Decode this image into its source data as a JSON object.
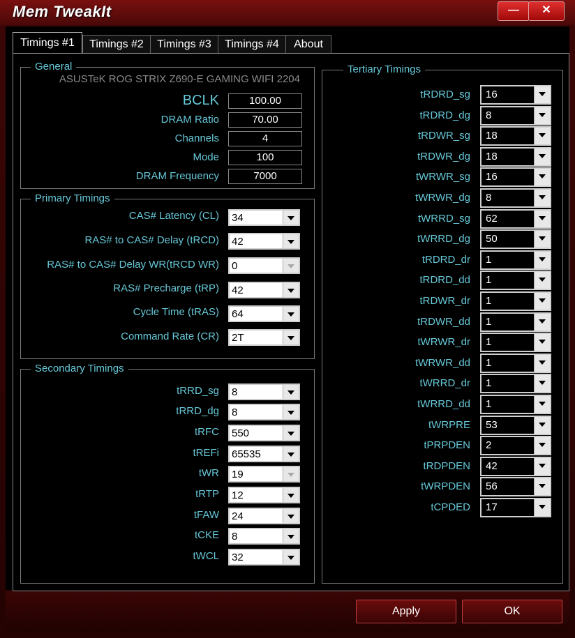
{
  "window": {
    "title": "Mem TweakIt",
    "minimize": "—",
    "close": "✕"
  },
  "tabs": [
    "Timings #1",
    "Timings #2",
    "Timings #3",
    "Timings #4",
    "About"
  ],
  "general": {
    "title": "General",
    "board": "ASUSTeK ROG STRIX Z690-E GAMING WIFI 2204",
    "fields": [
      {
        "label": "BCLK",
        "value": "100.00"
      },
      {
        "label": "DRAM Ratio",
        "value": "70.00"
      },
      {
        "label": "Channels",
        "value": "4"
      },
      {
        "label": "Mode",
        "value": "100"
      },
      {
        "label": "DRAM Frequency",
        "value": "7000"
      }
    ]
  },
  "primary": {
    "title": "Primary Timings",
    "rows": [
      {
        "label": "CAS# Latency (CL)",
        "value": "34"
      },
      {
        "label": "RAS# to CAS# Delay (tRCD)",
        "value": "42"
      },
      {
        "label": "RAS# to CAS# Delay WR(tRCD WR)",
        "value": "0"
      },
      {
        "label": "RAS# Precharge (tRP)",
        "value": "42"
      },
      {
        "label": "Cycle Time (tRAS)",
        "value": "64"
      },
      {
        "label": "Command Rate (CR)",
        "value": "2T"
      }
    ]
  },
  "secondary": {
    "title": "Secondary Timings",
    "rows": [
      {
        "label": "tRRD_sg",
        "value": "8"
      },
      {
        "label": "tRRD_dg",
        "value": "8"
      },
      {
        "label": "tRFC",
        "value": "550"
      },
      {
        "label": "tREFi",
        "value": "65535"
      },
      {
        "label": "tWR",
        "value": "19"
      },
      {
        "label": "tRTP",
        "value": "12"
      },
      {
        "label": "tFAW",
        "value": "24"
      },
      {
        "label": "tCKE",
        "value": "8"
      },
      {
        "label": "tWCL",
        "value": "32"
      }
    ]
  },
  "tertiary": {
    "title": "Tertiary Timings",
    "rows": [
      {
        "label": "tRDRD_sg",
        "value": "16"
      },
      {
        "label": "tRDRD_dg",
        "value": "8"
      },
      {
        "label": "tRDWR_sg",
        "value": "18"
      },
      {
        "label": "tRDWR_dg",
        "value": "18"
      },
      {
        "label": "tWRWR_sg",
        "value": "16"
      },
      {
        "label": "tWRWR_dg",
        "value": "8"
      },
      {
        "label": "tWRRD_sg",
        "value": "62"
      },
      {
        "label": "tWRRD_dg",
        "value": "50"
      },
      {
        "label": "tRDRD_dr",
        "value": "1"
      },
      {
        "label": "tRDRD_dd",
        "value": "1"
      },
      {
        "label": "tRDWR_dr",
        "value": "1"
      },
      {
        "label": "tRDWR_dd",
        "value": "1"
      },
      {
        "label": "tWRWR_dr",
        "value": "1"
      },
      {
        "label": "tWRWR_dd",
        "value": "1"
      },
      {
        "label": "tWRRD_dr",
        "value": "1"
      },
      {
        "label": "tWRRD_dd",
        "value": "1"
      },
      {
        "label": "tWRPRE",
        "value": "53"
      },
      {
        "label": "tPRPDEN",
        "value": "2"
      },
      {
        "label": "tRDPDEN",
        "value": "42"
      },
      {
        "label": "tWRPDEN",
        "value": "56"
      },
      {
        "label": "tCPDED",
        "value": "17"
      }
    ]
  },
  "buttons": {
    "apply": "Apply",
    "ok": "OK"
  }
}
